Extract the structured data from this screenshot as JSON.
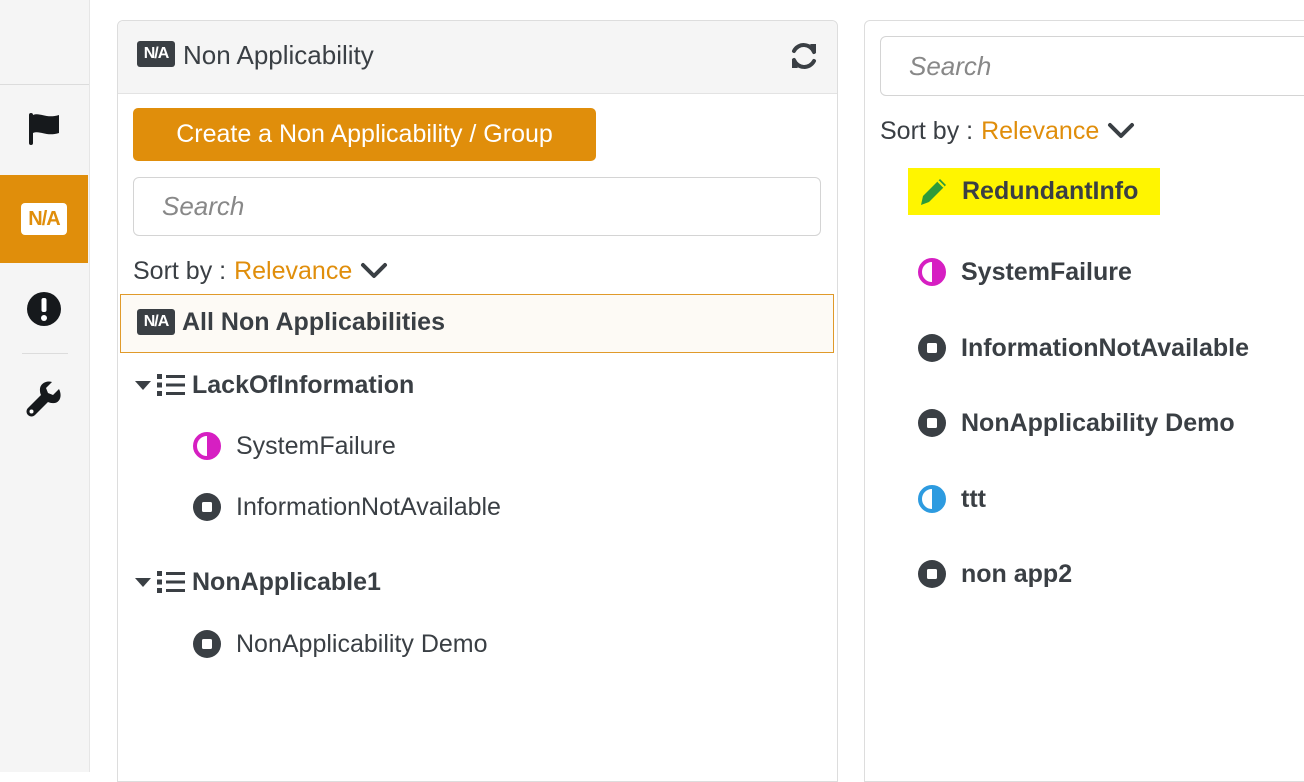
{
  "rail": {
    "items": [
      {
        "name": "flag-icon"
      },
      {
        "name": "na-icon",
        "label": "N/A",
        "active": true
      },
      {
        "name": "alert-icon"
      },
      {
        "name": "wrench-icon"
      }
    ]
  },
  "left_panel": {
    "badge": "N/A",
    "title": "Non Applicability",
    "create_button": "Create a Non Applicability / Group",
    "search_placeholder": "Search",
    "sort_label": "Sort by :",
    "sort_value": "Relevance",
    "all_item": {
      "badge": "N/A",
      "label": "All Non Applicabilities"
    },
    "groups": [
      {
        "label": "LackOfInformation",
        "items": [
          {
            "label": "SystemFailure",
            "icon": "half-circle-icon",
            "color": "#d61fc2"
          },
          {
            "label": "InformationNotAvailable",
            "icon": "stop-circle-icon",
            "color": "#3a3f44"
          }
        ]
      },
      {
        "label": "NonApplicable1",
        "items": [
          {
            "label": "NonApplicability Demo",
            "icon": "stop-circle-icon",
            "color": "#3a3f44"
          }
        ]
      }
    ]
  },
  "right_panel": {
    "search_placeholder": "Search",
    "sort_label": "Sort by :",
    "sort_value": "Relevance",
    "items": [
      {
        "label": "RedundantInfo",
        "icon": "pen-icon",
        "color": "#2e9b3a",
        "highlight": "#fff500"
      },
      {
        "label": "SystemFailure",
        "icon": "half-circle-icon",
        "color": "#d61fc2"
      },
      {
        "label": "InformationNotAvailable",
        "icon": "stop-circle-icon",
        "color": "#3a3f44"
      },
      {
        "label": "NonApplicability Demo",
        "icon": "stop-circle-icon",
        "color": "#3a3f44"
      },
      {
        "label": "ttt",
        "icon": "half-circle-icon",
        "color": "#2d9be0"
      },
      {
        "label": "non app2",
        "icon": "stop-circle-icon",
        "color": "#3a3f44"
      }
    ]
  },
  "colors": {
    "accent": "#e08e0b",
    "dark": "#3a3f44",
    "highlight": "#fff500"
  }
}
